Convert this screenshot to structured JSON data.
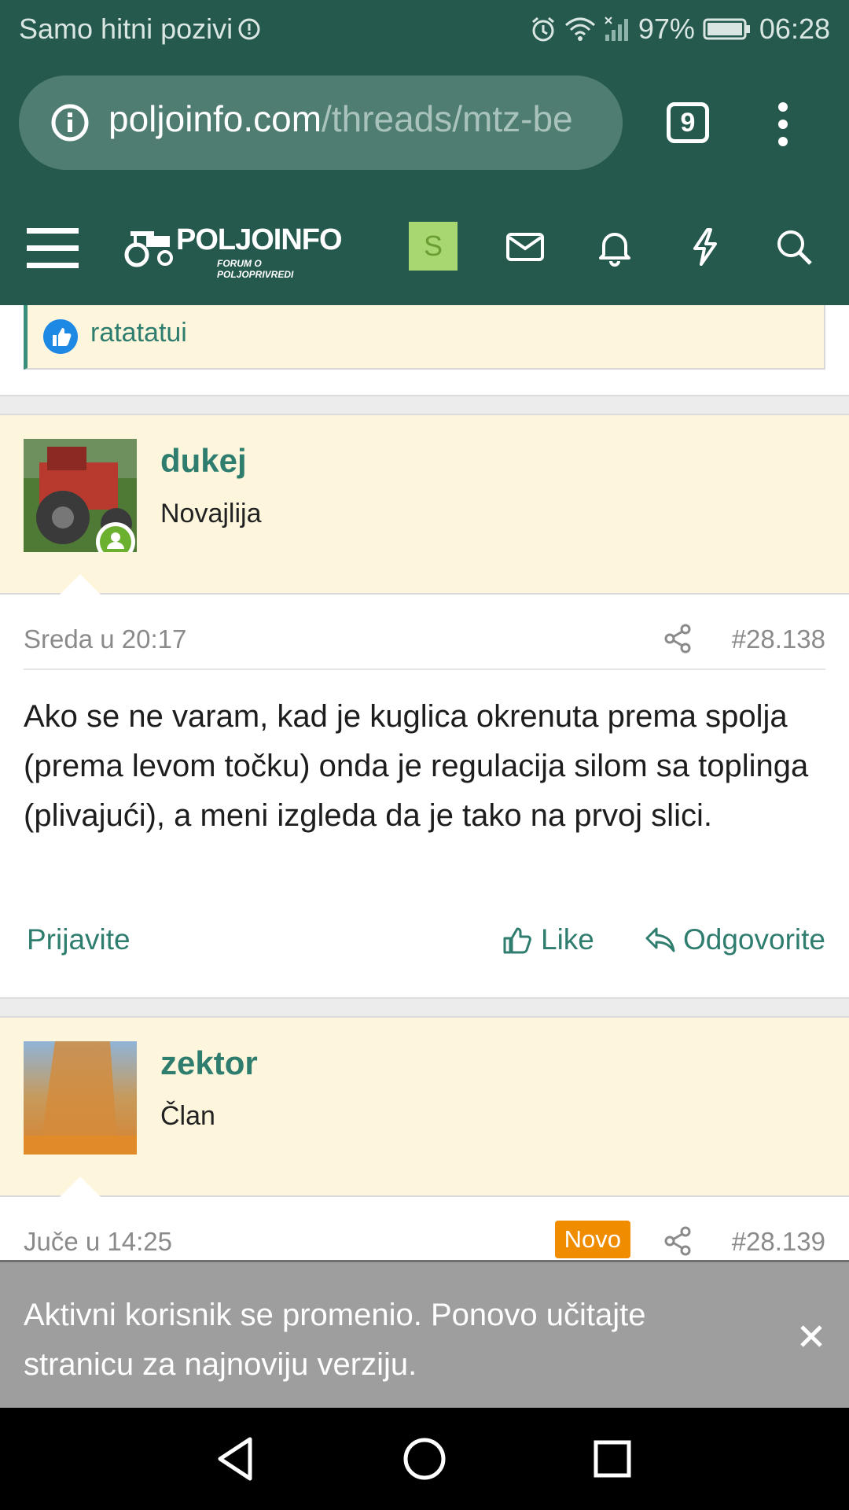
{
  "status_bar": {
    "carrier": "Samo hitni pozivi",
    "battery": "97%",
    "time": "06:28"
  },
  "browser": {
    "url_host": "poljoinfo.com",
    "url_path": "/threads/mtz-be",
    "tab_count": "9"
  },
  "forum_nav": {
    "logo_name": "POLJOINFO",
    "logo_tagline": "FORUM O POLJOPRIVREDI",
    "user_initial": "S"
  },
  "quote": {
    "liked_by": "ratatatui"
  },
  "posts": [
    {
      "username": "dukej",
      "role": "Novajlija",
      "date": "Sreda u 20:17",
      "number": "#28.138",
      "body": "Ako se ne varam, kad je kuglica okrenuta prema spolja (prema levom točku) onda je regulacija silom sa toplinga (plivajući), a meni izgleda da je tako na prvoj slici.",
      "report_label": "Prijavite",
      "like_label": "Like",
      "reply_label": "Odgovorite"
    },
    {
      "username": "zektor",
      "role": "Član",
      "date": "Juče u 14:25",
      "badge": "Novo",
      "number": "#28.139"
    }
  ],
  "notice": {
    "message": "Aktivni korisnik se promenio. Ponovo učitajte stranicu za najnoviju verziju."
  },
  "colors": {
    "header_bg": "#26594e",
    "accent": "#2e7d6e",
    "post_header_bg": "#fdf6dd",
    "badge_new": "#f08c00"
  }
}
